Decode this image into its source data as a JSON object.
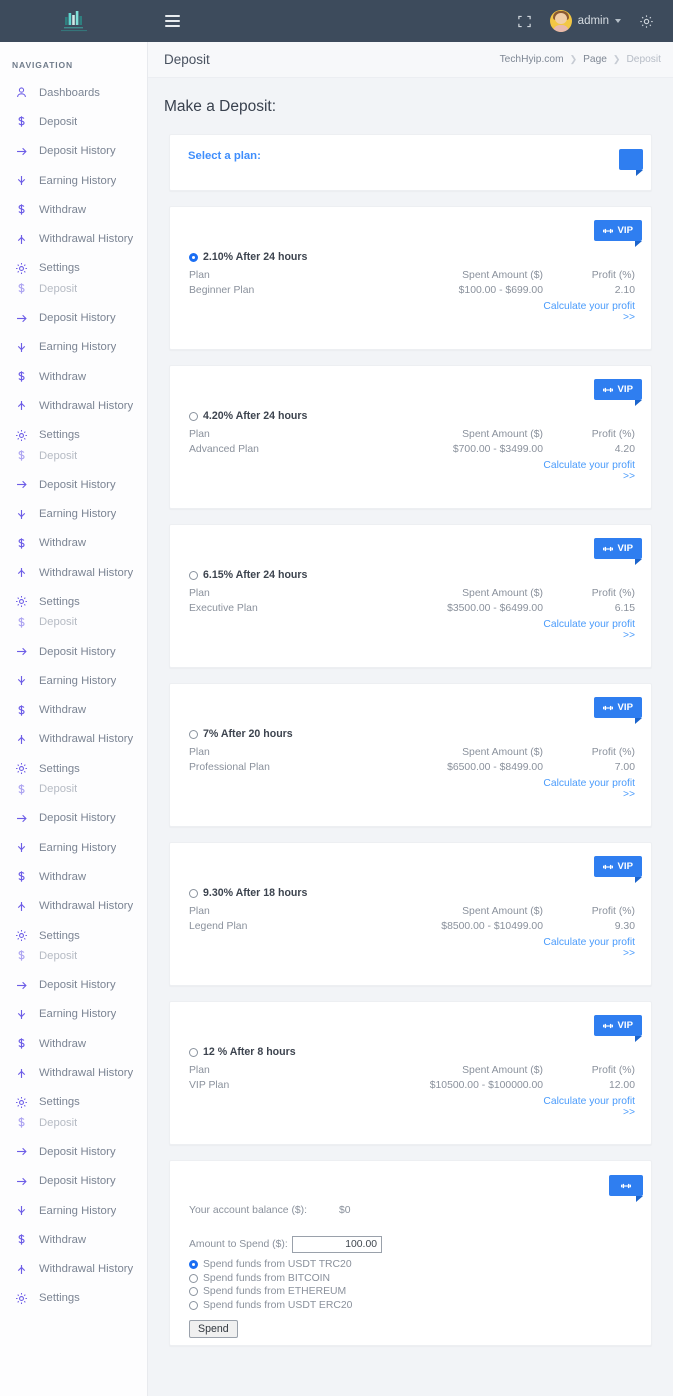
{
  "topbar": {
    "logo_name": "logo-bars-icon",
    "logo_caption": "TECH HYIP",
    "menu_icon": "hamburger-icon",
    "fullscreen_icon": "fullscreen-icon",
    "user_name": "admin",
    "settings_icon": "gear-icon"
  },
  "sidebar": {
    "heading": "NAVIGATION",
    "items": [
      {
        "label": "Dashboards",
        "icon": "user-icon"
      },
      {
        "label": "Deposit",
        "icon": "dollar-icon"
      },
      {
        "label": "Deposit History",
        "icon": "arrow-right-icon"
      },
      {
        "label": "Earning History",
        "icon": "arrow-down-icon"
      },
      {
        "label": "Withdraw",
        "icon": "dollar-icon"
      },
      {
        "label": "Withdrawal History",
        "icon": "arrow-up-icon"
      },
      {
        "label": "Settings",
        "icon": "gear-icon"
      }
    ],
    "repeat_items": [
      {
        "label": "Deposit",
        "icon": "dollar-icon"
      },
      {
        "label": "Deposit History",
        "icon": "arrow-right-icon"
      },
      {
        "label": "Earning History",
        "icon": "arrow-down-icon"
      },
      {
        "label": "Withdraw",
        "icon": "dollar-icon"
      },
      {
        "label": "Withdrawal History",
        "icon": "arrow-up-icon"
      },
      {
        "label": "Settings",
        "icon": "gear-icon"
      }
    ],
    "tail_items": [
      {
        "label": "Deposit",
        "icon": "dollar-icon"
      },
      {
        "label": "Deposit History",
        "icon": "arrow-right-icon"
      },
      {
        "label": "Deposit History",
        "icon": "arrow-right-icon"
      },
      {
        "label": "Earning History",
        "icon": "arrow-down-icon"
      },
      {
        "label": "Withdraw",
        "icon": "dollar-icon"
      },
      {
        "label": "Withdrawal History",
        "icon": "arrow-up-icon"
      },
      {
        "label": "Settings",
        "icon": "gear-icon"
      }
    ]
  },
  "page": {
    "title": "Deposit",
    "breadcrumb": {
      "root": "TechHyip.com",
      "middle": "Page",
      "current": "Deposit"
    },
    "heading": "Make a Deposit:"
  },
  "select_plan": {
    "label": "Select a plan:",
    "ribbon_label": ""
  },
  "table_headers": {
    "plan": "Plan",
    "spent": "Spent Amount ($)",
    "profit": "Profit (%)"
  },
  "calculate_link": "Calculate your profit >>",
  "ribbon": {
    "label": "VIP",
    "icon": "dumbbell-icon"
  },
  "plans": [
    {
      "rate": "2.10% After 24 hours",
      "name": "Beginner Plan",
      "spent": "$100.00 - $699.00",
      "profit": "2.10",
      "selected": true
    },
    {
      "rate": "4.20% After 24 hours",
      "name": "Advanced Plan",
      "spent": "$700.00 - $3499.00",
      "profit": "4.20",
      "selected": false
    },
    {
      "rate": "6.15% After 24 hours",
      "name": "Executive Plan",
      "spent": "$3500.00 - $6499.00",
      "profit": "6.15",
      "selected": false
    },
    {
      "rate": "7% After 20 hours",
      "name": "Professional Plan",
      "spent": "$6500.00 - $8499.00",
      "profit": "7.00",
      "selected": false
    },
    {
      "rate": "9.30% After 18 hours",
      "name": "Legend Plan",
      "spent": "$8500.00 - $10499.00",
      "profit": "9.30",
      "selected": false
    },
    {
      "rate": "12 % After 8 hours",
      "name": "VIP Plan",
      "spent": "$10500.00 - $100000.00",
      "profit": "12.00",
      "selected": false
    }
  ],
  "spend_form": {
    "balance_label": "Your account balance ($):",
    "balance_value": "$0",
    "amount_label": "Amount to Spend ($):",
    "amount_value": "100.00",
    "options": [
      {
        "label": "Spend funds from USDT TRC20",
        "selected": true
      },
      {
        "label": "Spend funds from BITCOIN",
        "selected": false
      },
      {
        "label": "Spend funds from ETHEREUM",
        "selected": false
      },
      {
        "label": "Spend funds from USDT ERC20",
        "selected": false
      }
    ],
    "submit_label": "Spend"
  },
  "colors": {
    "topbar": "#3d4b5c",
    "accent_blue": "#2f7ef0",
    "link_blue": "#4a9bfb",
    "nav_icon": "#6c5ce7",
    "page_bg": "#f2f4f7"
  }
}
